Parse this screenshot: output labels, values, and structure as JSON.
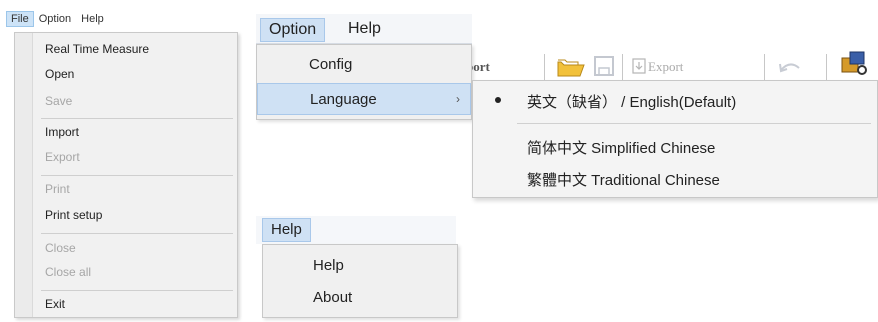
{
  "file_panel": {
    "menubar": [
      "File",
      "Option",
      "Help"
    ],
    "items": [
      {
        "label": "Real Time Measure",
        "enabled": true
      },
      {
        "label": "Open",
        "enabled": true
      },
      {
        "label": "Save",
        "enabled": false
      },
      {
        "label": "Import",
        "enabled": true
      },
      {
        "label": "Export",
        "enabled": false
      },
      {
        "label": "Print",
        "enabled": false
      },
      {
        "label": "Print setup",
        "enabled": true
      },
      {
        "label": "Close",
        "enabled": false
      },
      {
        "label": "Close all",
        "enabled": false
      },
      {
        "label": "Exit",
        "enabled": true
      }
    ]
  },
  "option_panel": {
    "menubar": [
      "Option",
      "Help"
    ],
    "items": [
      "Config",
      "Language"
    ],
    "language_submenu": [
      {
        "label": "英文（缺省） / English(Default)",
        "selected": true
      },
      {
        "label": "简体中文 Simplified Chinese",
        "selected": false
      },
      {
        "label": "繁體中文 Traditional Chinese",
        "selected": false
      }
    ],
    "toolbar": {
      "import_partial": "port",
      "export_label": "Export"
    }
  },
  "help_panel": {
    "menubar": [
      "Help"
    ],
    "items": [
      "Help",
      "About"
    ]
  },
  "colors": {
    "highlight": "#cfe1f4",
    "highlight_border": "#a9c8ea",
    "menu_bg": "#f0f0f0",
    "disabled": "#a6a6a6",
    "folder": "#f2c13a"
  }
}
